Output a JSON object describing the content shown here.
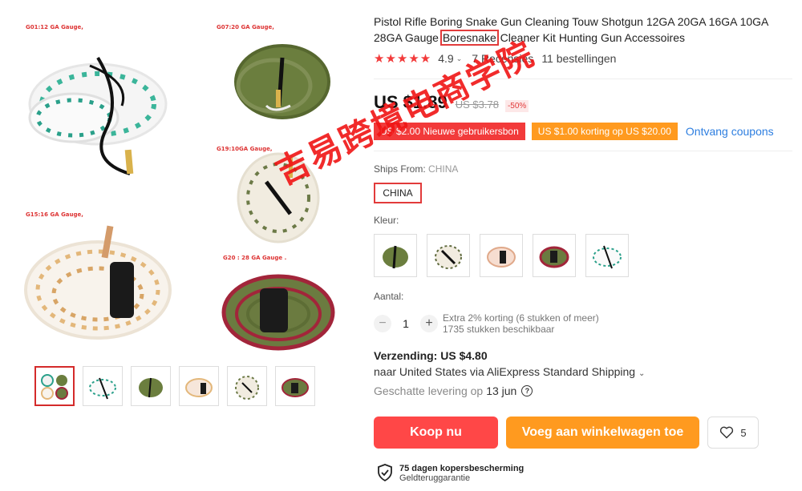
{
  "gallery": {
    "labels": [
      "G01:12 GA Gauge,",
      "G07:20 GA Gauge,",
      "G19:10GA Gauge,",
      "G15:16 GA Gauge,",
      "G20 : 28 GA Gauge ."
    ]
  },
  "product": {
    "title_before": "Pistol Rifle Boring Snake Gun Cleaning Touw Shotgun 12GA 20GA 16GA 10GA 28GA Gauge ",
    "title_highlight": "Boresnake",
    "title_after": " Cleaner Kit Hunting Gun Accessoires",
    "stars": "★★★★★",
    "rating": "4.9",
    "reviews": "7 Recensies",
    "orders": "11 bestellingen",
    "price": "US $1.89",
    "old_price": "US $3.78",
    "discount": "-50%"
  },
  "coupons": {
    "new_user": "US $2.00 Nieuwe gebruikersbon",
    "discount": "US $1.00 korting op US $20.00",
    "link": "Ontvang coupons"
  },
  "ships": {
    "label": "Ships From:",
    "value": "CHINA",
    "option": "CHINA"
  },
  "color": {
    "label": "Kleur:"
  },
  "quantity": {
    "label": "Aantal:",
    "value": "1",
    "info1": "Extra 2% korting (6 stukken of meer)",
    "info2": "1735 stukken beschikbaar"
  },
  "shipping": {
    "heading": "Verzending: US $4.80",
    "line": "naar United States via AliExpress Standard Shipping",
    "est_label": "Geschatte levering op",
    "est_date": "13 jun"
  },
  "actions": {
    "buy": "Koop nu",
    "cart": "Voeg aan winkelwagen toe",
    "wish_count": "5"
  },
  "protection": {
    "title": "75 dagen kopersbescherming",
    "subtitle": "Geldteruggarantie"
  },
  "watermark": "吉易跨境电商学院",
  "colors": {
    "accent": "#ff4747",
    "orange": "#ff9a1f",
    "link": "#2d7ee0"
  }
}
